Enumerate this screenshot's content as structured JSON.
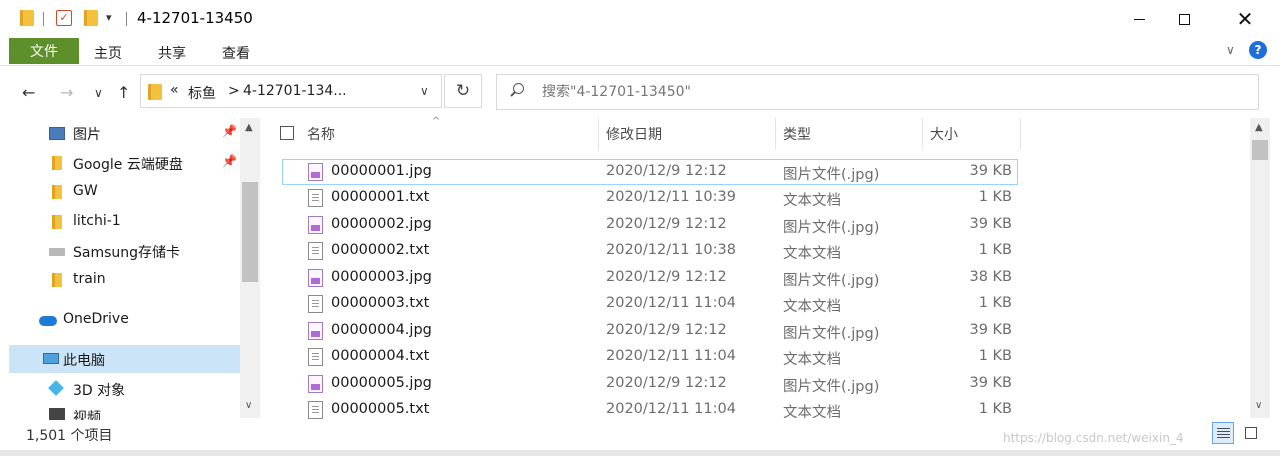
{
  "window": {
    "title": "4-12701-13450",
    "minimize_label": "",
    "maximize_label": "",
    "close_glyph": "✕"
  },
  "ribbon": {
    "tabs": [
      "文件",
      "主页",
      "共享",
      "查看"
    ],
    "help_glyph": "?",
    "expand_glyph": "∨",
    "file_tab_color": "#5d8f2a"
  },
  "nav": {
    "back_glyph": "←",
    "forward_glyph": "→",
    "recent_glyph": "∨",
    "up_glyph": "↑",
    "breadcrumb": [
      "«",
      "标鱼",
      ">",
      "4-12701-134..."
    ],
    "address_dropdown_glyph": "∨",
    "refresh_glyph": "↻",
    "search_placeholder": "搜索\"4-12701-13450\""
  },
  "sidebar": {
    "items": [
      {
        "label": "图片",
        "icon": "pictures-icon",
        "pinned": true
      },
      {
        "label": "Google 云端硬盘",
        "icon": "folder-icon",
        "pinned": true
      },
      {
        "label": "GW",
        "icon": "folder-icon",
        "pinned": false
      },
      {
        "label": "litchi-1",
        "icon": "folder-icon",
        "pinned": false
      },
      {
        "label": "Samsung存储卡",
        "icon": "drive-icon",
        "pinned": false
      },
      {
        "label": "train",
        "icon": "folder-icon",
        "pinned": false
      },
      {
        "label": "OneDrive",
        "icon": "onedrive-icon",
        "pinned": false
      },
      {
        "label": "此电脑",
        "icon": "this-pc-icon",
        "pinned": false,
        "selected": true
      },
      {
        "label": "3D 对象",
        "icon": "3d-objects-icon",
        "pinned": false
      },
      {
        "label": "视频",
        "icon": "videos-icon",
        "pinned": false
      }
    ],
    "pin_glyph": "📌",
    "scroll_up_glyph": "▲",
    "scroll_down_glyph": "∨"
  },
  "columns": {
    "name": "名称",
    "date": "修改日期",
    "type": "类型",
    "size": "大小",
    "sort_caret": "^"
  },
  "files": [
    {
      "name": "00000001.jpg",
      "date": "2020/12/9 12:12",
      "type": "图片文件(.jpg)",
      "size": "39 KB",
      "kind": "jpg"
    },
    {
      "name": "00000001.txt",
      "date": "2020/12/11 10:39",
      "type": "文本文档",
      "size": "1 KB",
      "kind": "txt"
    },
    {
      "name": "00000002.jpg",
      "date": "2020/12/9 12:12",
      "type": "图片文件(.jpg)",
      "size": "39 KB",
      "kind": "jpg"
    },
    {
      "name": "00000002.txt",
      "date": "2020/12/11 10:38",
      "type": "文本文档",
      "size": "1 KB",
      "kind": "txt"
    },
    {
      "name": "00000003.jpg",
      "date": "2020/12/9 12:12",
      "type": "图片文件(.jpg)",
      "size": "38 KB",
      "kind": "jpg"
    },
    {
      "name": "00000003.txt",
      "date": "2020/12/11 11:04",
      "type": "文本文档",
      "size": "1 KB",
      "kind": "txt"
    },
    {
      "name": "00000004.jpg",
      "date": "2020/12/9 12:12",
      "type": "图片文件(.jpg)",
      "size": "39 KB",
      "kind": "jpg"
    },
    {
      "name": "00000004.txt",
      "date": "2020/12/11 11:04",
      "type": "文本文档",
      "size": "1 KB",
      "kind": "txt"
    },
    {
      "name": "00000005.jpg",
      "date": "2020/12/9 12:12",
      "type": "图片文件(.jpg)",
      "size": "39 KB",
      "kind": "jpg"
    },
    {
      "name": "00000005.txt",
      "date": "2020/12/11 11:04",
      "type": "文本文档",
      "size": "1 KB",
      "kind": "txt"
    }
  ],
  "status": {
    "item_count": "1,501 个项目"
  },
  "watermark": "https://blog.csdn.net/weixin_4"
}
